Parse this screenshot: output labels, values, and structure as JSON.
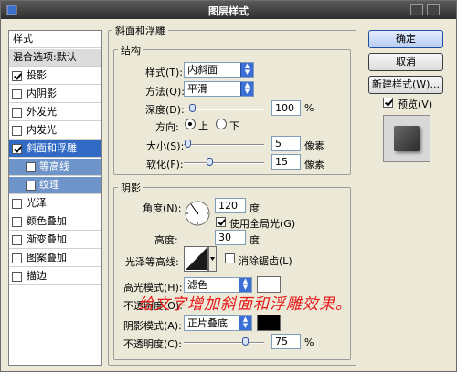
{
  "window": {
    "title": "图层样式"
  },
  "left_panel": {
    "header": "样式",
    "blend_default": "混合选项:默认",
    "items": [
      {
        "label": "投影",
        "checked": true
      },
      {
        "label": "内阴影",
        "checked": false
      },
      {
        "label": "外发光",
        "checked": false
      },
      {
        "label": "内发光",
        "checked": false
      },
      {
        "label": "斜面和浮雕",
        "checked": true
      },
      {
        "label": "等高线",
        "checked": false
      },
      {
        "label": "纹理",
        "checked": false
      },
      {
        "label": "光泽",
        "checked": false
      },
      {
        "label": "颜色叠加",
        "checked": false
      },
      {
        "label": "渐变叠加",
        "checked": false
      },
      {
        "label": "图案叠加",
        "checked": false
      },
      {
        "label": "描边",
        "checked": false
      }
    ]
  },
  "bevel": {
    "section_title": "斜面和浮雕",
    "structure": {
      "title": "结构",
      "style_label": "样式(T):",
      "style_value": "内斜面",
      "method_label": "方法(Q):",
      "method_value": "平滑",
      "depth_label": "深度(D):",
      "depth_value": "100",
      "depth_unit": "%",
      "direction_label": "方向:",
      "direction_up": "上",
      "direction_down": "下",
      "size_label": "大小(S):",
      "size_value": "5",
      "size_unit": "像素",
      "soften_label": "软化(F):",
      "soften_value": "15",
      "soften_unit": "像素"
    },
    "shading": {
      "title": "阴影",
      "angle_label": "角度(N):",
      "angle_value": "120",
      "angle_unit": "度",
      "global_light_label": "使用全局光(G)",
      "altitude_label": "高度:",
      "altitude_value": "30",
      "altitude_unit": "度",
      "gloss_contour_label": "光泽等高线:",
      "anti_alias_label": "消除锯齿(L)",
      "highlight_mode_label": "高光模式(H):",
      "highlight_mode_value": "滤色",
      "opacity1_label": "不透明度(O):",
      "shadow_mode_label": "阴影模式(A):",
      "shadow_mode_value": "正片叠底",
      "opacity2_label": "不透明度(C):",
      "opacity2_value": "75",
      "opacity_unit": "%"
    }
  },
  "buttons": {
    "ok": "确定",
    "cancel": "取消",
    "new_style": "新建样式(W)...",
    "preview_label": "预览(V)"
  },
  "annotation": "给文字增加斜面和浮雕效果。",
  "colors": {
    "accent": "#316ac5",
    "annotation": "#e81717",
    "shadow_swatch": "#000000",
    "highlight_swatch": "#ffffff"
  },
  "sliders": {
    "depth": 0.1,
    "size": 0.02,
    "soften": 0.3,
    "opacity2": 0.75
  }
}
